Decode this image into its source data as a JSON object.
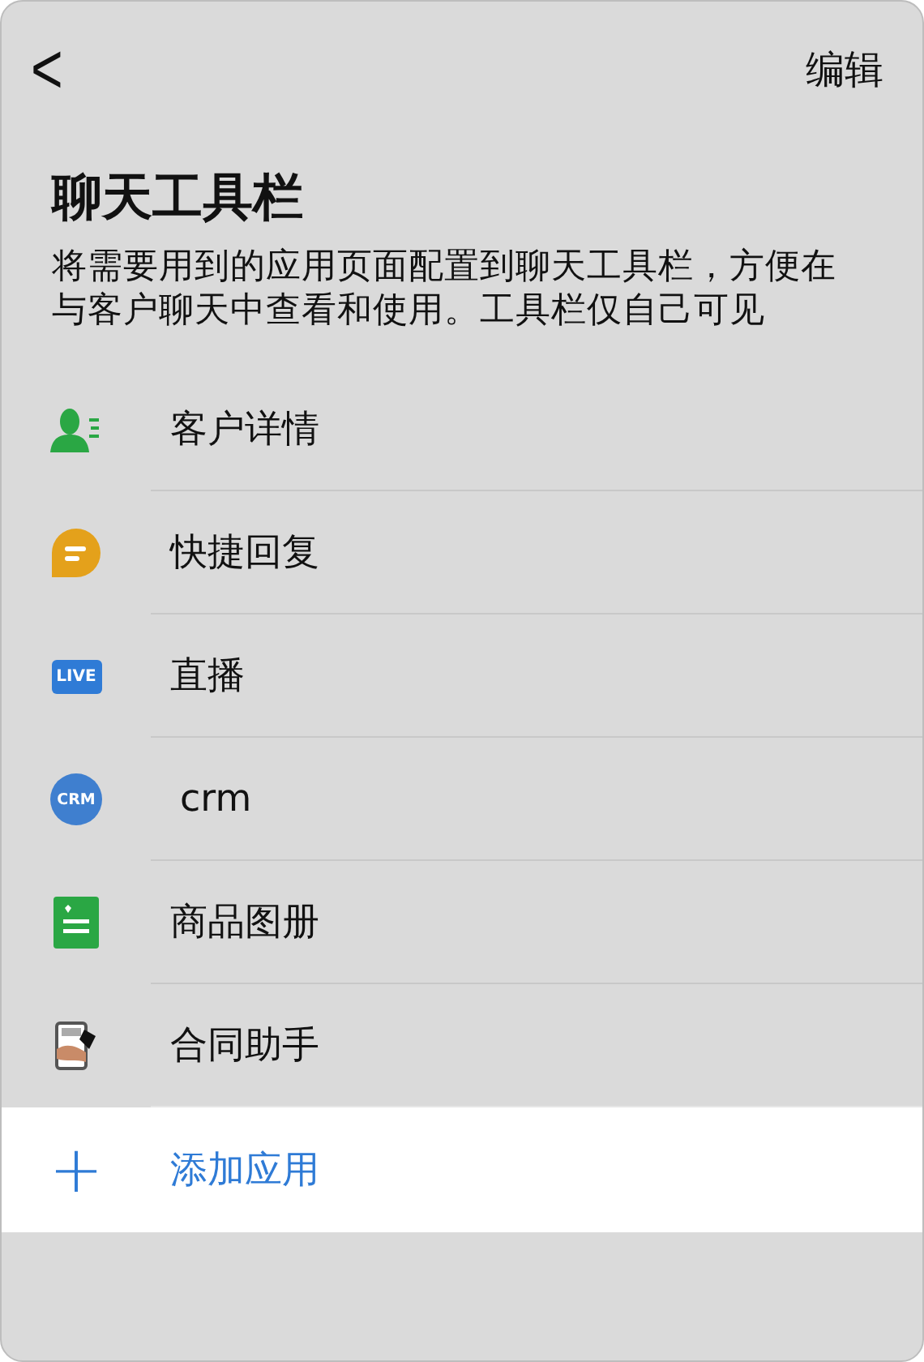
{
  "header": {
    "back": "<",
    "action": "编辑"
  },
  "title": "聊天工具栏",
  "description": "将需要用到的应用页面配置到聊天工具栏，方便在与客户聊天中查看和使用。工具栏仅自己可见",
  "items": [
    {
      "kind": "contact",
      "label": "客户详情"
    },
    {
      "kind": "reply",
      "label": "快捷回复"
    },
    {
      "kind": "live",
      "badge": "LIVE",
      "label": "直播"
    },
    {
      "kind": "crm",
      "badge": "CRM",
      "label": "crm"
    },
    {
      "kind": "catalog",
      "label": "商品图册"
    },
    {
      "kind": "contract",
      "label": "合同助手"
    }
  ],
  "add": {
    "icon": "+",
    "label": "添加应用"
  }
}
